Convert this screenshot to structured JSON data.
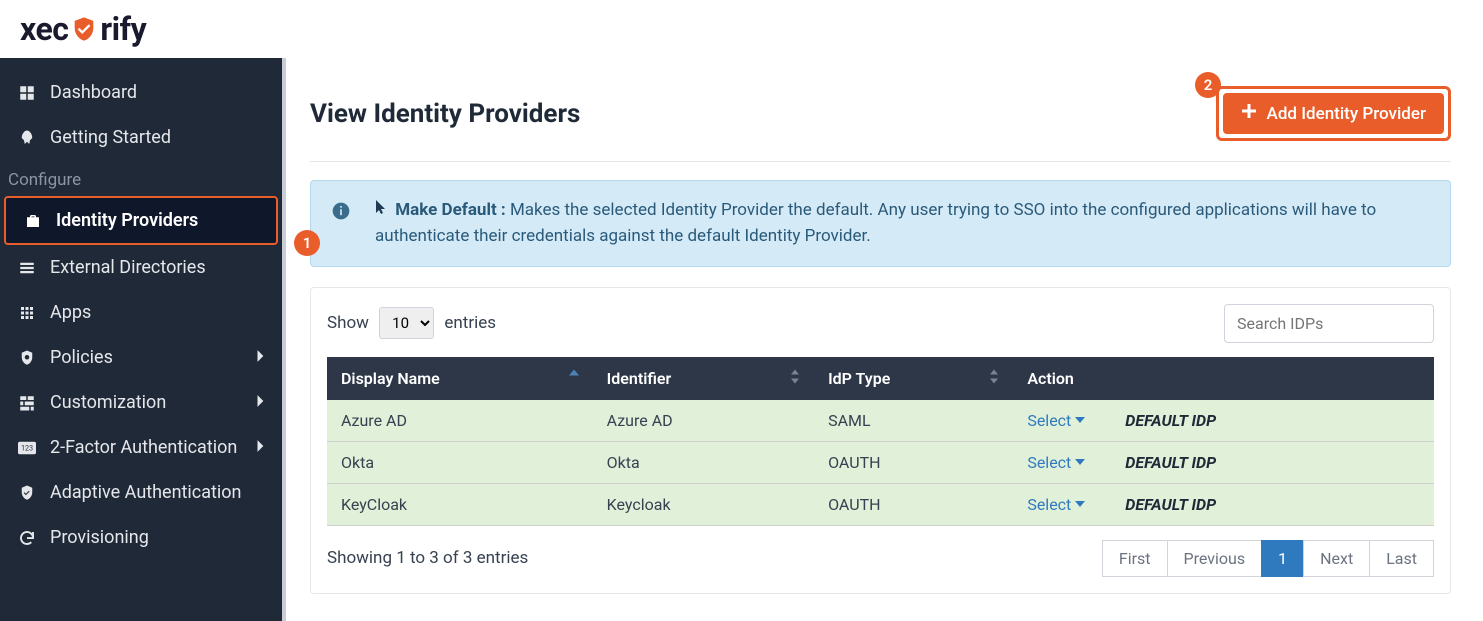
{
  "logo": {
    "part1": "xec",
    "part2": "rify"
  },
  "sidebar": {
    "items": [
      {
        "label": "Dashboard",
        "icon": "dashboard"
      },
      {
        "label": "Getting Started",
        "icon": "rocket"
      }
    ],
    "section_label": "Configure",
    "config_items": [
      {
        "label": "Identity Providers",
        "icon": "briefcase",
        "active": true
      },
      {
        "label": "External Directories",
        "icon": "list"
      },
      {
        "label": "Apps",
        "icon": "grid"
      },
      {
        "label": "Policies",
        "icon": "shield-search",
        "chevron": true
      },
      {
        "label": "Customization",
        "icon": "sliders",
        "chevron": true
      },
      {
        "label": "2-Factor Authentication",
        "icon": "num",
        "chevron": true
      },
      {
        "label": "Adaptive Authentication",
        "icon": "shield-check"
      },
      {
        "label": "Provisioning",
        "icon": "sync"
      }
    ]
  },
  "page": {
    "title": "View Identity Providers",
    "add_button": "Add Identity Provider",
    "info_title": "Make Default :",
    "info_body": "Makes the selected Identity Provider the default. Any user trying to SSO into the configured applications will have to authenticate their credentials against the default Identity Provider."
  },
  "annotations": {
    "a1": "1",
    "a2": "2"
  },
  "table": {
    "show_label_pre": "Show",
    "show_label_post": "entries",
    "page_size": "10",
    "search_placeholder": "Search IDPs",
    "headers": {
      "display_name": "Display Name",
      "identifier": "Identifier",
      "idp_type": "IdP Type",
      "action": "Action"
    },
    "action_select": "Select",
    "default_label": "DEFAULT IDP",
    "rows": [
      {
        "display_name": "Azure AD",
        "identifier": "Azure AD",
        "idp_type": "SAML"
      },
      {
        "display_name": "Okta",
        "identifier": "Okta",
        "idp_type": "OAUTH"
      },
      {
        "display_name": "KeyCloak",
        "identifier": "Keycloak",
        "idp_type": "OAUTH"
      }
    ],
    "footer_info": "Showing 1 to 3 of 3 entries",
    "pager": {
      "first": "First",
      "prev": "Previous",
      "page": "1",
      "next": "Next",
      "last": "Last"
    }
  }
}
